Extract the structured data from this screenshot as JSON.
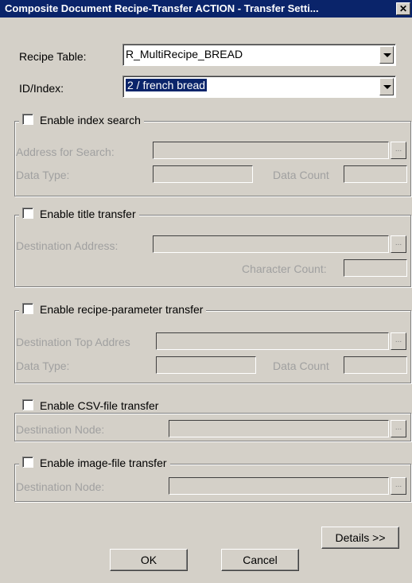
{
  "window": {
    "title": "Composite Document Recipe-Transfer ACTION - Transfer Setti...",
    "close_glyph": "✕"
  },
  "recipe_table": {
    "label": "Recipe Table:",
    "value": "R_MultiRecipe_BREAD"
  },
  "id_index": {
    "label": "ID/Index:",
    "value": "2 / french bread"
  },
  "index_search": {
    "title": "Enable index search",
    "address_label": "Address for Search:",
    "data_type_label": "Data Type:",
    "data_count_label": "Data Count"
  },
  "title_transfer": {
    "title": "Enable title transfer",
    "destination_label": "Destination Address:",
    "char_count_label": "Character Count:"
  },
  "recipe_param": {
    "title": "Enable recipe-parameter transfer",
    "destination_label": "Destination Top Addres",
    "data_type_label": "Data Type:",
    "data_count_label": "Data Count"
  },
  "csv_transfer": {
    "title": "Enable CSV-file transfer",
    "node_label": "Destination Node:"
  },
  "image_transfer": {
    "title": "Enable image-file transfer",
    "node_label": "Destination Node:"
  },
  "buttons": {
    "details": "Details >>",
    "ok": "OK",
    "cancel": "Cancel",
    "ellipsis": "..."
  }
}
